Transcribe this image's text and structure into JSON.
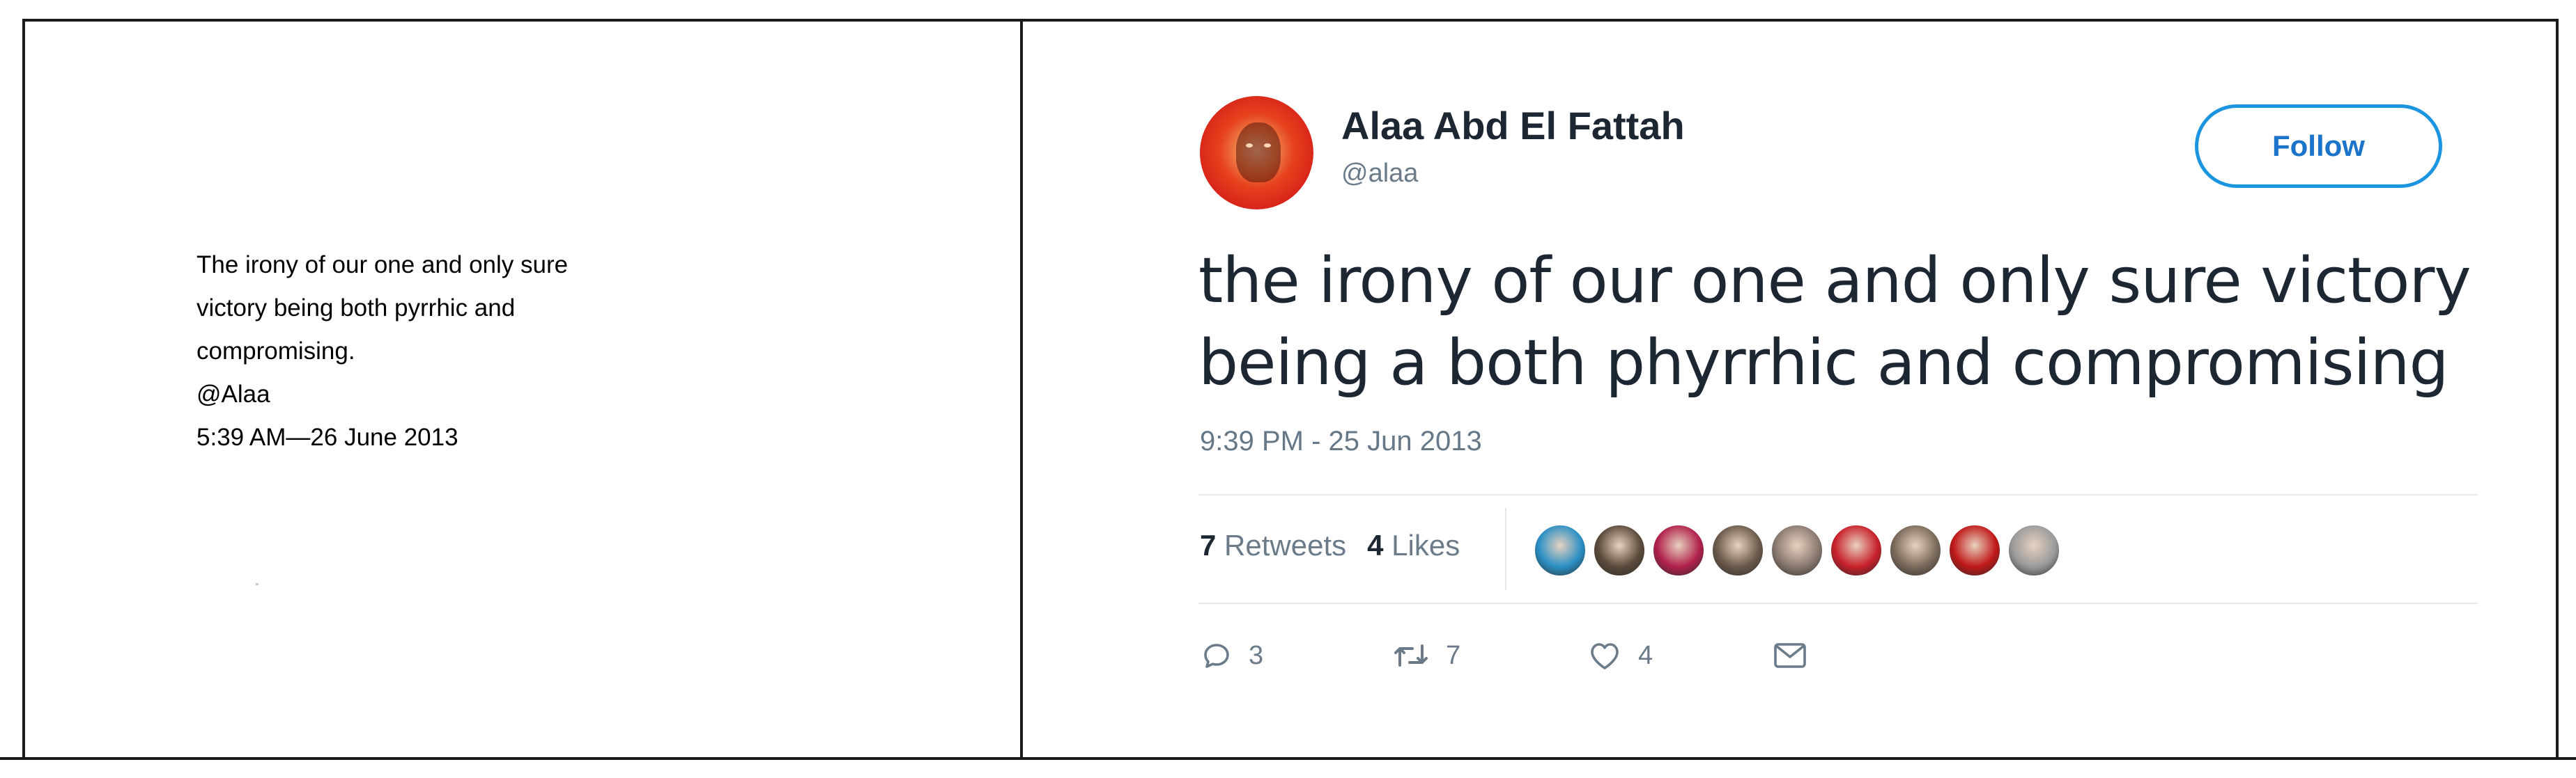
{
  "caption": {
    "lines": [
      "The irony of our one and only sure",
      "victory being both pyrrhic and",
      "compromising.",
      "@Alaa",
      "5:39 AM—26 June 2013"
    ]
  },
  "tweet": {
    "display_name": "Alaa Abd El Fattah",
    "handle": "@alaa",
    "follow_label": "Follow",
    "text_lines": [
      "the irony of our one and only sure victory",
      "being a both phyrrhic and compromising"
    ],
    "timestamp": "9:39 PM - 25 Jun 2013",
    "retweets": "7",
    "retweets_label": "Retweets",
    "likes": "4",
    "likes_label": "Likes",
    "liker_avatar_colors": [
      "#2a8fc4",
      "#5a4a3a",
      "#b0204a",
      "#6a5a4a",
      "#8a7a70",
      "#c8202a",
      "#7a6a5a",
      "#c01818",
      "#9a9a9a"
    ],
    "reply_count": "3",
    "retweet_count": "7",
    "like_count": "4",
    "icons": [
      "reply-icon",
      "retweet-icon",
      "like-icon",
      "message-icon"
    ],
    "accent_color": "#1b95e0"
  }
}
